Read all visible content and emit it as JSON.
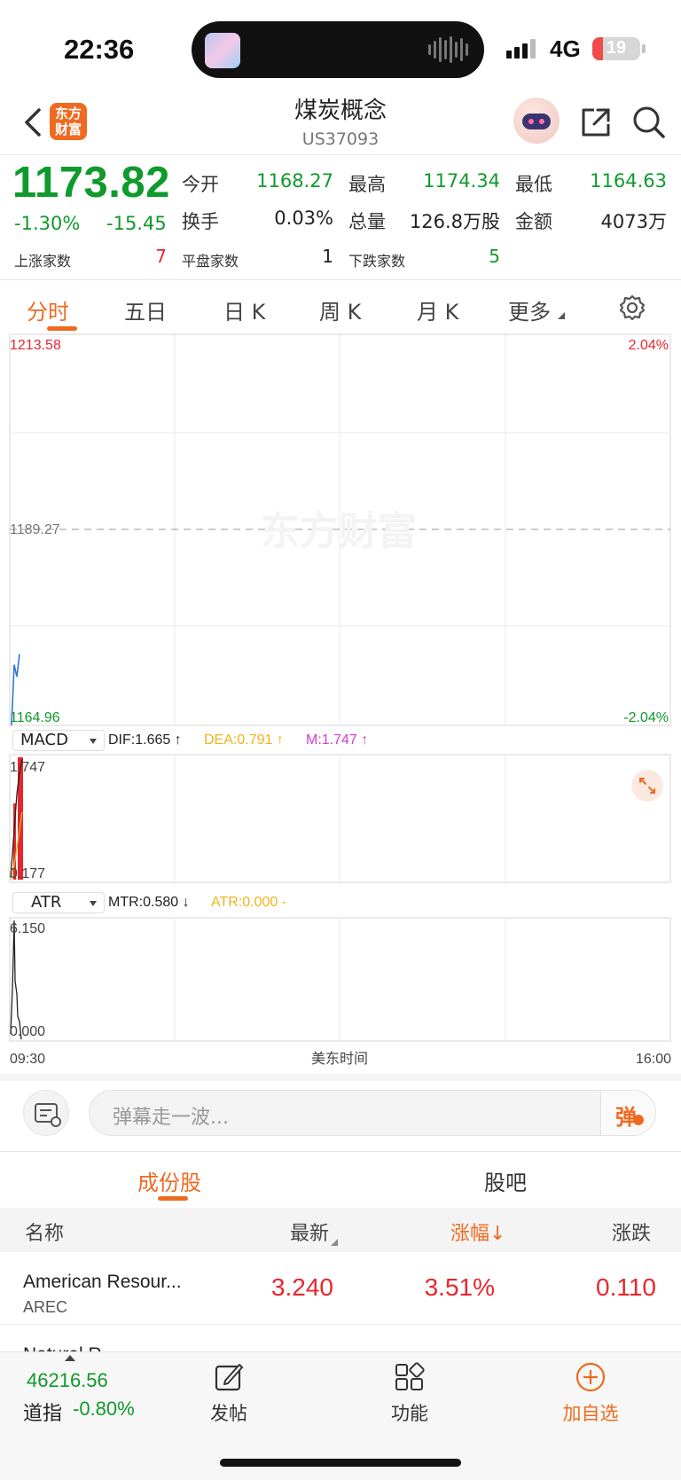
{
  "status": {
    "time": "22:36",
    "network": "4G",
    "battery": "19"
  },
  "header": {
    "title": "煤炭概念",
    "code": "US37093",
    "logo_line1": "东方",
    "logo_line2": "财富"
  },
  "quote": {
    "price": "1173.82",
    "change_pct": "-1.30%",
    "change_abs": "-15.45",
    "open_label": "今开",
    "open": "1168.27",
    "high_label": "最高",
    "high": "1174.34",
    "low_label": "最低",
    "low": "1164.63",
    "turnover_label": "换手",
    "turnover": "0.03%",
    "volume_label": "总量",
    "volume": "126.8万股",
    "amount_label": "金额",
    "amount": "4073万",
    "up_label": "上涨家数",
    "up": "7",
    "flat_label": "平盘家数",
    "flat": "1",
    "down_label": "下跌家数",
    "down": "5"
  },
  "period_tabs": [
    "分时",
    "五日",
    "日 K",
    "周 K",
    "月 K",
    "更多"
  ],
  "chart": {
    "price_top": "1213.58",
    "price_mid": "1189.27",
    "price_bottom": "1164.96",
    "pct_top": "2.04%",
    "pct_bottom": "-2.04%",
    "watermark": "东方财富",
    "macd_select": "MACD",
    "dif": "DIF:1.665 ↑",
    "dea": "DEA:0.791 ↑",
    "m": "M:1.747 ↑",
    "macd_top": "1.747",
    "macd_bottom": "0.177",
    "atr_select": "ATR",
    "mtr": "MTR:0.580 ↓",
    "atr": "ATR:0.000 -",
    "atr_top": "6.150",
    "atr_bottom": "0.000",
    "time_start": "09:30",
    "time_label": "美东时间",
    "time_end": "16:00"
  },
  "chart_data": {
    "type": "line",
    "x": [
      "09:30",
      "09:31",
      "09:32",
      "09:33"
    ],
    "series": [
      {
        "values": [
          1164.96,
          1172.5,
          1171.0,
          1173.82
        ]
      }
    ],
    "ylim": [
      1164.96,
      1213.58
    ],
    "reference": 1189.27,
    "xlabel": "美东时间"
  },
  "danmu": {
    "placeholder": "弹幕走一波...",
    "button": "弹"
  },
  "sub_tabs": [
    "成份股",
    "股吧"
  ],
  "table": {
    "headers": [
      "名称",
      "最新",
      "涨幅↓",
      "涨跌"
    ],
    "rows": [
      {
        "name": "American Resour...",
        "code": "AREC",
        "last": "3.240",
        "pct": "3.51%",
        "chg": "0.110"
      },
      {
        "name": "Natural R...",
        "code": "",
        "last": "",
        "pct": "",
        "chg": ""
      }
    ]
  },
  "bottom_bar": {
    "index_value": "46216.56",
    "index_name": "道指",
    "index_change": "-0.80%",
    "post_label": "发帖",
    "func_label": "功能",
    "add_label": "加自选"
  },
  "colors": {
    "up": "#e8262d",
    "down": "#0f9a2c",
    "accent": "#ef6a20"
  }
}
